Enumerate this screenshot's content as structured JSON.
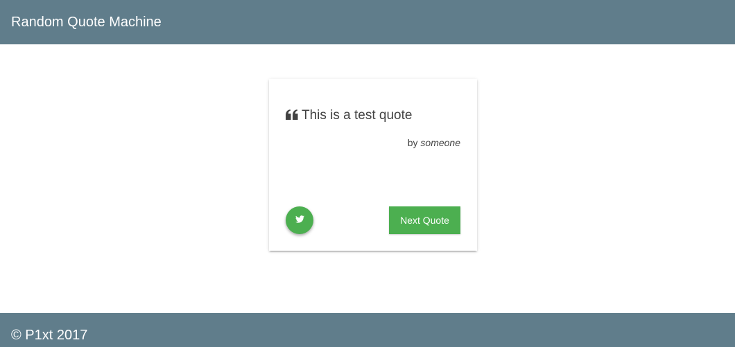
{
  "header": {
    "title": "Random Quote Machine",
    "color": "#607d8b"
  },
  "quote": {
    "icon": "quote-left-icon",
    "text": "This is a test quote",
    "author_prefix": "by",
    "author": "someone"
  },
  "actions": {
    "tweet_icon": "twitter-icon",
    "next_label": "Next Quote",
    "accent_color": "#4caf50"
  },
  "footer": {
    "text": "© P1xt 2017"
  }
}
